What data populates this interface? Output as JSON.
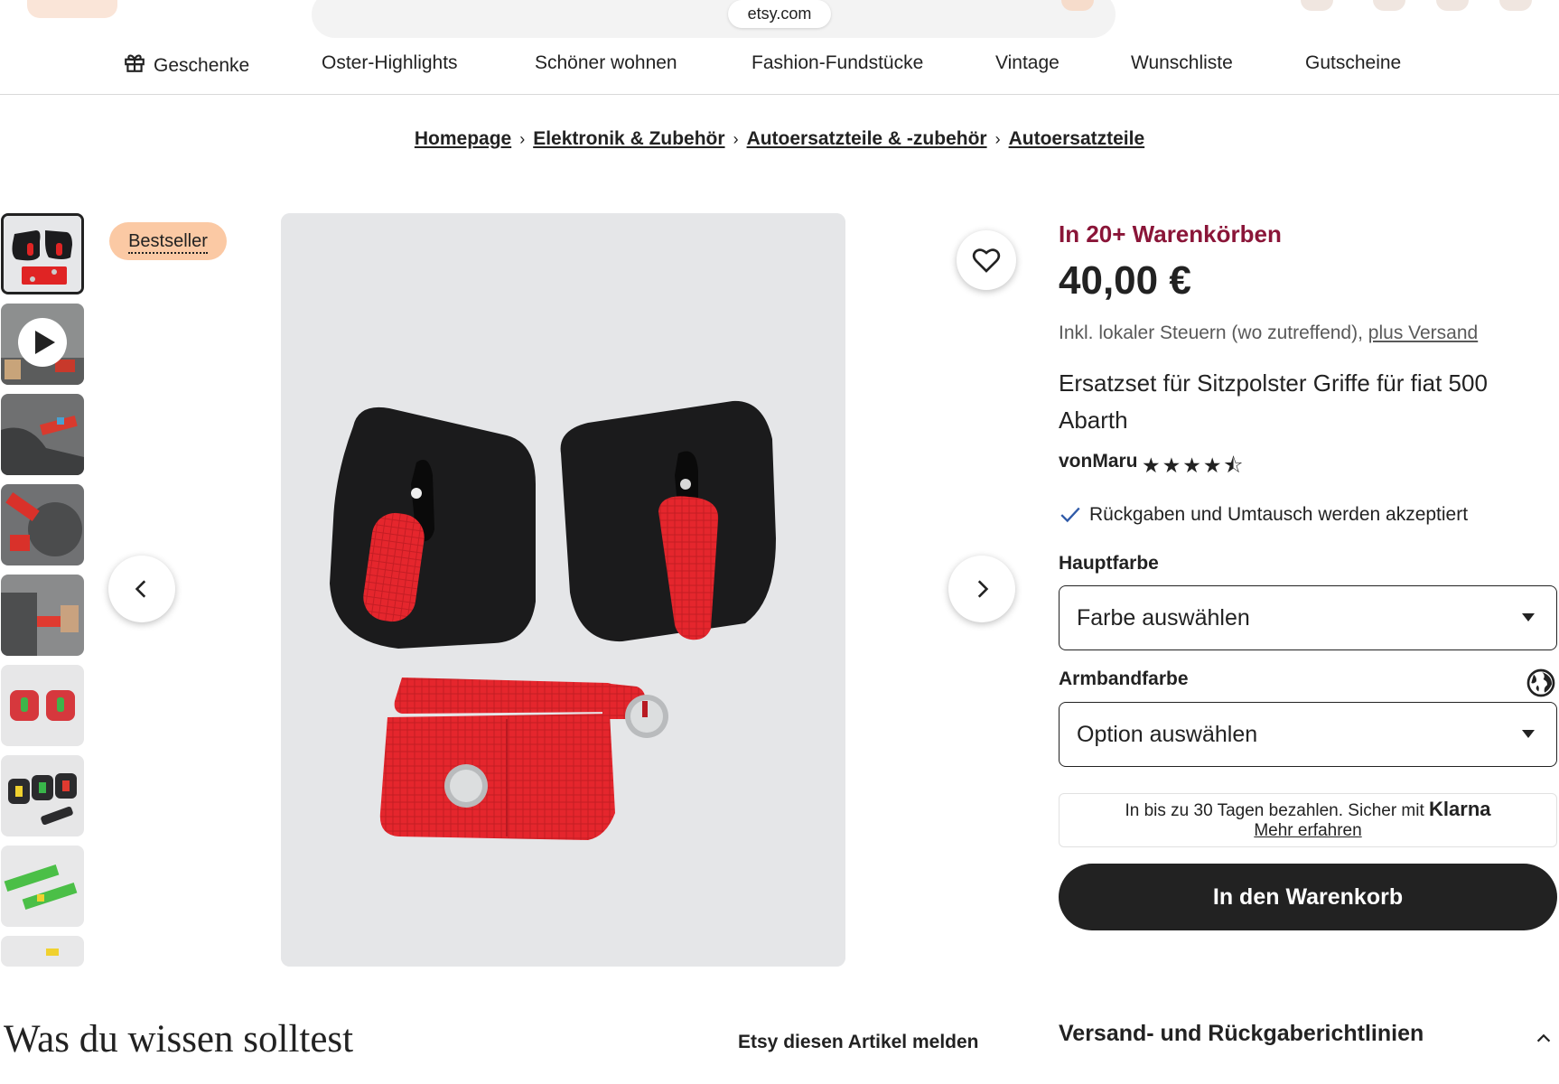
{
  "browser": {
    "url": "etsy.com"
  },
  "nav": {
    "items": [
      {
        "label": "Geschenke",
        "icon": "gift-icon"
      },
      {
        "label": "Oster-Highlights"
      },
      {
        "label": "Schöner wohnen"
      },
      {
        "label": "Fashion-Fundstücke"
      },
      {
        "label": "Vintage"
      },
      {
        "label": "Wunschliste"
      },
      {
        "label": "Gutscheine"
      }
    ]
  },
  "breadcrumb": [
    "Homepage",
    "Elektronik & Zubehör",
    "Autoersatzteile & -zubehör",
    "Autoersatzteile"
  ],
  "gallery": {
    "badge": "Bestseller",
    "prev_icon": "chevron-left-icon",
    "next_icon": "chevron-right-icon",
    "favorite_icon": "heart-icon",
    "video_icon": "play-icon"
  },
  "product": {
    "carts": "In 20+ Warenkörben",
    "price": "40,00 €",
    "tax_text": "Inkl. lokaler Steuern (wo zutreffend),",
    "shipping_link": "plus Versand",
    "title": "Ersatzset für Sitzpolster Griffe für fiat 500 Abarth",
    "seller": "vonMaru",
    "rating": 4.5,
    "rating_stars": "★★★★⯪",
    "returns": "Rückgaben und Umtausch werden akzeptiert",
    "options": [
      {
        "label": "Hauptfarbe",
        "value": "Farbe auswählen"
      },
      {
        "label": "Armbandfarbe",
        "value": "Option auswählen"
      }
    ],
    "klarna_text": "In bis zu 30 Tagen bezahlen. Sicher mit",
    "klarna_brand": "Klarna",
    "klarna_link": "Mehr erfahren",
    "add_to_cart": "In den Warenkorb"
  },
  "footer": {
    "know_title": "Was du wissen solltest",
    "report": "Etsy diesen Artikel melden",
    "shipping_policies": "Versand- und Rückgaberichtlinien"
  },
  "colors": {
    "accent_red": "#8a1538",
    "dark": "#222222",
    "badge": "#fbc9a4"
  }
}
